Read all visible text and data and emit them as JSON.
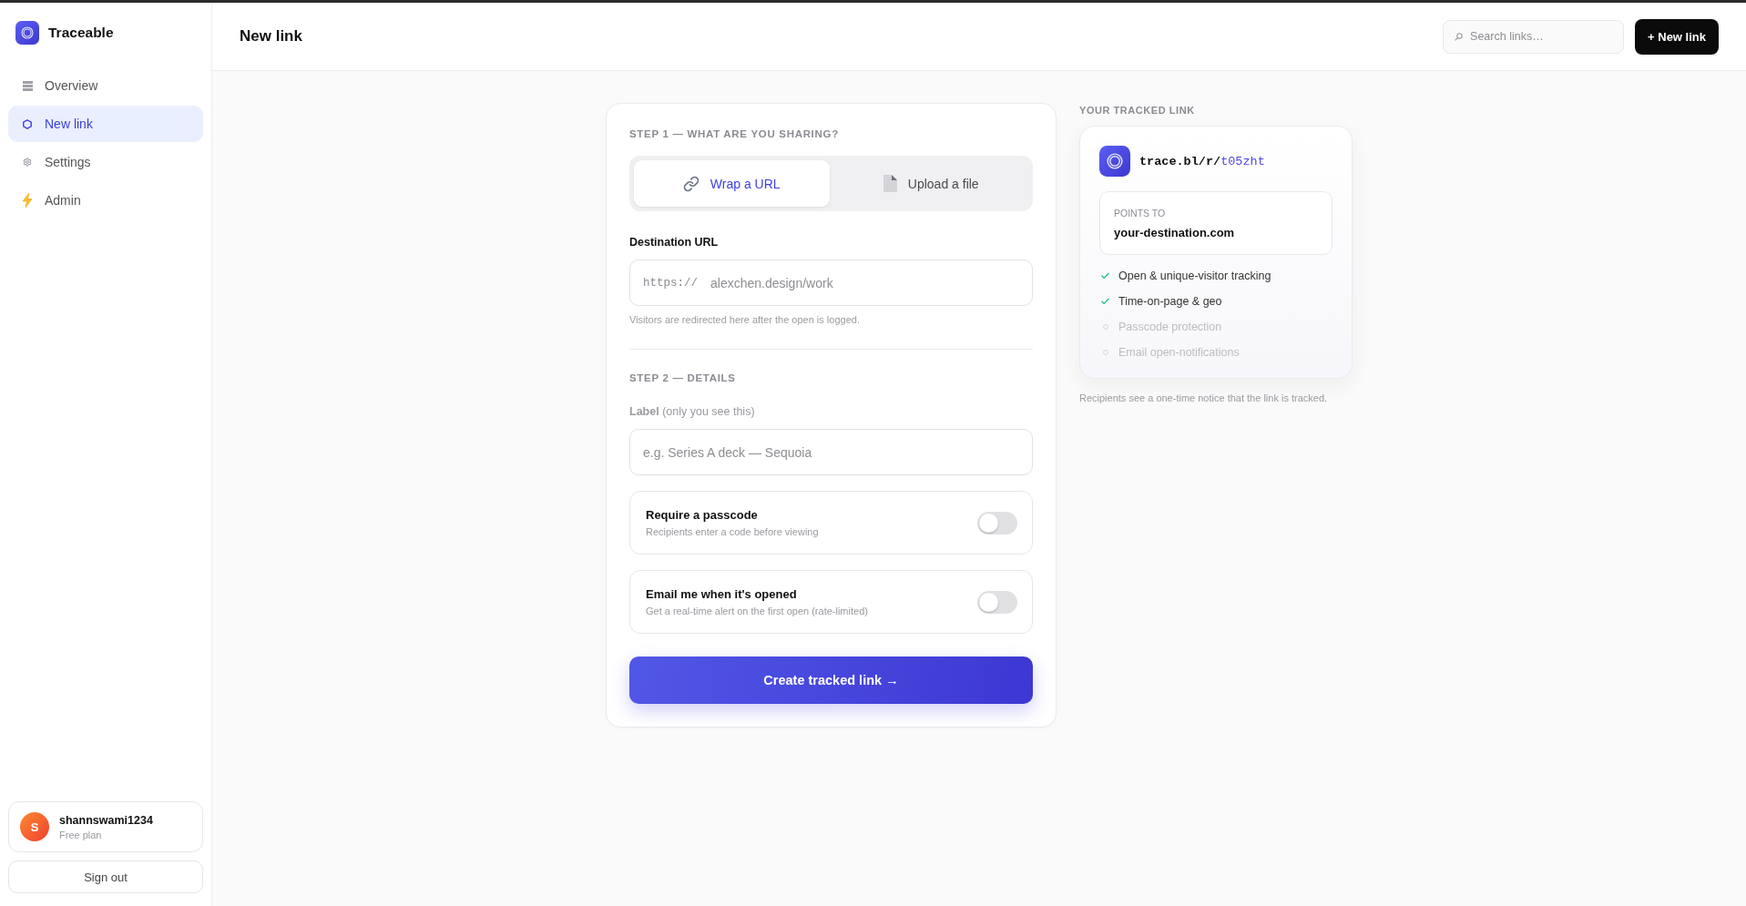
{
  "app": {
    "name": "Traceable"
  },
  "sidebar": {
    "items": [
      {
        "label": "Overview",
        "kind": "list",
        "selected": false
      },
      {
        "label": "New link",
        "kind": "hexagon",
        "selected": true
      },
      {
        "label": "Settings",
        "kind": "gear",
        "selected": false
      },
      {
        "label": "Admin",
        "kind": "bolt",
        "selected": false
      }
    ]
  },
  "account": {
    "initial": "S",
    "name": "shannswami1234",
    "plan": "Free plan",
    "sign_out": "Sign out"
  },
  "header": {
    "title": "New link",
    "search": {
      "placeholder": "Search links…"
    },
    "new_button": "+ New link"
  },
  "form": {
    "step_1": "STEP 1 — WHAT ARE YOU SHARING?",
    "source_tabs": [
      {
        "label": "Wrap a URL",
        "kind": "link",
        "selected": true
      },
      {
        "label": "Upload a file",
        "kind": "file",
        "selected": false
      }
    ],
    "destination": {
      "label": "Destination URL",
      "prefix": "https://",
      "placeholder": "alexchen.design/work",
      "hint": "Visitors are redirected here after the open is logged."
    },
    "step_2": "STEP 2 — DETAILS",
    "label_field": {
      "label": "**Label** (only you see this)",
      "placeholder": "e.g. Series A deck — Sequoia"
    },
    "options": [
      {
        "title": "Require a passcode",
        "description": "Recipients enter a code before viewing",
        "on": false
      },
      {
        "title": "Email me when it's opened",
        "description": "Get a real-time alert on the first open (rate-limited)",
        "on": false
      }
    ],
    "submit": "Create tracked link →"
  },
  "preview": {
    "heading": "YOUR TRACKED LINK",
    "link_base": "trace.bl/r/",
    "link_slug": "t05zht",
    "points_to_label": "POINTS TO",
    "points_to": "your-destination.com",
    "features": [
      {
        "label": "Open & unique-visitor tracking",
        "checked": true
      },
      {
        "label": "Time-on-page & geo",
        "checked": true
      },
      {
        "label": "Passcode protection",
        "checked": false
      },
      {
        "label": "Email open-notifications",
        "checked": false
      }
    ],
    "note": "Recipients see a one-time notice that the link is tracked."
  }
}
